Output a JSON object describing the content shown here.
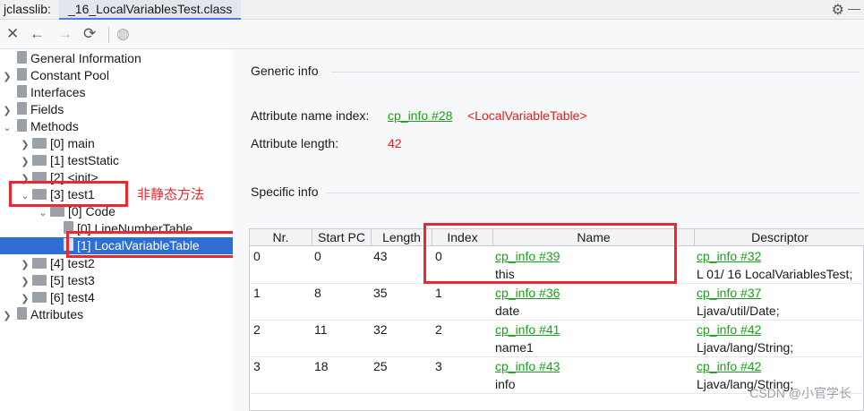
{
  "tabs": {
    "plugin": "jclasslib:",
    "file": "_16_LocalVariablesTest.class"
  },
  "toolbar": {
    "close": "✕",
    "back": "←",
    "forward": "→",
    "refresh": "⟳",
    "web": "◍"
  },
  "tree": {
    "general": "General Information",
    "constant_pool": "Constant Pool",
    "interfaces": "Interfaces",
    "fields": "Fields",
    "methods": "Methods",
    "main": "[0] main",
    "testStatic": "[1] testStatic",
    "init": "[2] <init>",
    "test1": "[3] test1",
    "code": "[0] Code",
    "lnt": "[0] LineNumberTable",
    "lvt": "[1] LocalVariableTable",
    "test2": "[4] test2",
    "test3": "[5] test3",
    "test4": "[6] test4",
    "attributes": "Attributes"
  },
  "annotation": "非静态方法",
  "generic": {
    "title": "Generic info",
    "name_index_label": "Attribute name index:",
    "name_index_link": "cp_info #28",
    "name_index_value": "<LocalVariableTable>",
    "length_label": "Attribute length:",
    "length_value": "42"
  },
  "specific": {
    "title": "Specific info"
  },
  "table": {
    "headers": [
      "Nr.",
      "Start PC",
      "Length",
      "Index",
      "Name",
      "Descriptor"
    ],
    "rows": [
      {
        "nr": "0",
        "start_pc": "0",
        "length": "43",
        "index": "0",
        "name_link": "cp_info #39",
        "name": "this",
        "desc_link": "cp_info #32",
        "desc": "L 01/ 16 LocalVariablesTest;"
      },
      {
        "nr": "1",
        "start_pc": "8",
        "length": "35",
        "index": "1",
        "name_link": "cp_info #36",
        "name": "date",
        "desc_link": "cp_info #37",
        "desc": "Ljava/util/Date;"
      },
      {
        "nr": "2",
        "start_pc": "11",
        "length": "32",
        "index": "2",
        "name_link": "cp_info #41",
        "name": "name1",
        "desc_link": "cp_info #42",
        "desc": "Ljava/lang/String;"
      },
      {
        "nr": "3",
        "start_pc": "18",
        "length": "25",
        "index": "3",
        "name_link": "cp_info #43",
        "name": "info",
        "desc_link": "cp_info #42",
        "desc": "Ljava/lang/String;"
      }
    ]
  },
  "watermark": "CSDN @小官学长",
  "colors": {
    "selection": "#2f6fd5",
    "link": "#18a218",
    "annotation": "#e8292f"
  }
}
